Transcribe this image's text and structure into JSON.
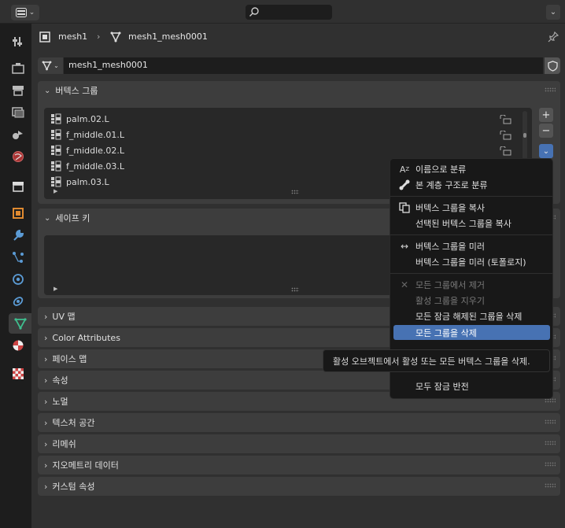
{
  "topbar": {
    "search_placeholder": "",
    "options_label": "⌄"
  },
  "breadcrumb": {
    "object": "mesh1",
    "mesh": "mesh1_mesh0001"
  },
  "mesh_data": {
    "name": "mesh1_mesh0001"
  },
  "vertex_groups": {
    "title": "버텍스 그룹",
    "items": [
      "palm.02.L",
      "f_middle.01.L",
      "f_middle.02.L",
      "f_middle.03.L",
      "palm.03.L"
    ]
  },
  "shape_keys": {
    "title": "세이프 키"
  },
  "sections": [
    "UV 맵",
    "Color Attributes",
    "페이스 맵",
    "속성",
    "노멀",
    "텍스처 공간",
    "리메쉬",
    "지오메트리 데이터",
    "커스텀 속성"
  ],
  "menu": {
    "sort_by_name": "이름으로 분류",
    "sort_by_bone": "본 계층 구조로 분류",
    "copy_group": "버텍스 그룹을 복사",
    "copy_to_selected": "선택된 버텍스 그룹을 복사",
    "mirror_group": "버텍스 그룹을 미러",
    "mirror_topology": "버텍스 그룹을 미러 (토폴로지)",
    "remove_from_all": "모든 그룹에서 제거",
    "clear_active": "활성 그룹을 지우기",
    "delete_unlocked": "모든 잠금 해제된 그룹을 삭제",
    "delete_all": "모든 그룹을 삭제",
    "invert_locks": "모두 잠금 반전"
  },
  "tooltip": "활성 오브젝트에서 활성 또는 모든 버텍스 그룹을 삭제.",
  "colors": {
    "accent": "#4772b3",
    "panel": "#303030",
    "section": "#3d3d3d"
  }
}
